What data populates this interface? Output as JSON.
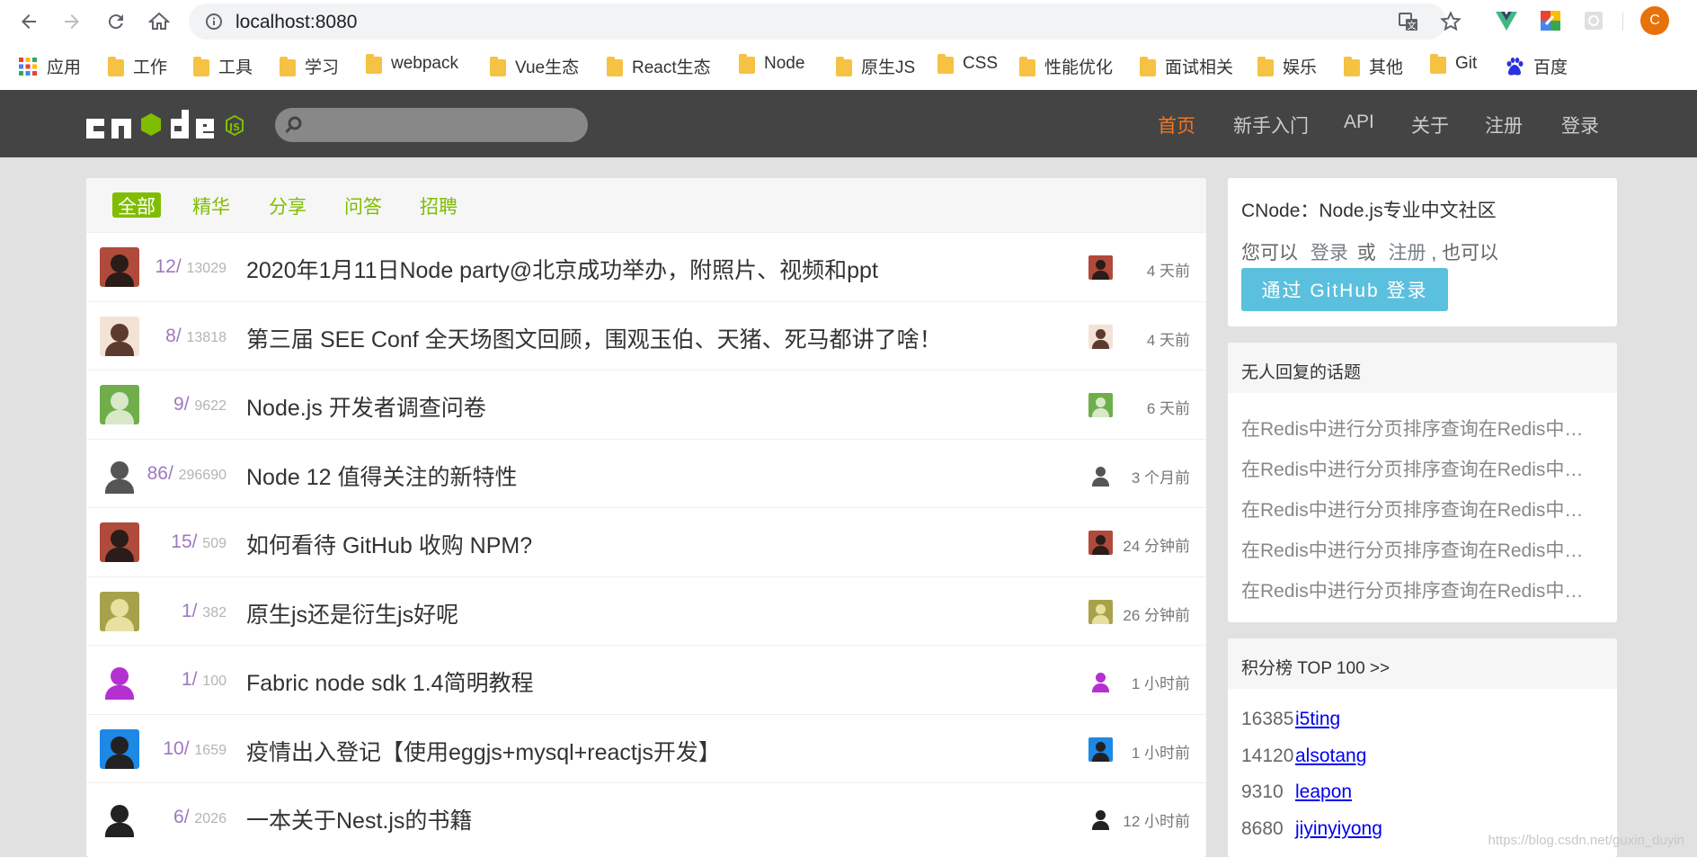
{
  "browser": {
    "url": "localhost:8080",
    "profile_initial": "C",
    "bookmarks": [
      "应用",
      "工作",
      "工具",
      "学习",
      "webpack",
      "Vue生态",
      "React生态",
      "Node",
      "原生JS",
      "CSS",
      "性能优化",
      "面试相关",
      "娱乐",
      "其他",
      "Git",
      "百度"
    ]
  },
  "header": {
    "nav": [
      "首页",
      "新手入门",
      "API",
      "关于",
      "注册",
      "登录"
    ]
  },
  "tabs": [
    "全部",
    "精华",
    "分享",
    "问答",
    "招聘"
  ],
  "topics": [
    {
      "replies": "12",
      "visits": "13029",
      "title": "2020年1月11日Node party@北京成功举办，附照片、视频和ppt",
      "time": "4 天前"
    },
    {
      "replies": "8",
      "visits": "13818",
      "title": "第三届 SEE Conf 全天场图文回顾，围观玉伯、天猪、死马都讲了啥！",
      "time": "4 天前"
    },
    {
      "replies": "9",
      "visits": "9622",
      "title": "Node.js 开发者调查问卷",
      "time": "6 天前"
    },
    {
      "replies": "86",
      "visits": "296690",
      "title": "Node 12 值得关注的新特性",
      "time": "3 个月前"
    },
    {
      "replies": "15",
      "visits": "509",
      "title": "如何看待 GitHub 收购 NPM?",
      "time": "24 分钟前"
    },
    {
      "replies": "1",
      "visits": "382",
      "title": "原生js还是衍生js好呢",
      "time": "26 分钟前"
    },
    {
      "replies": "1",
      "visits": "100",
      "title": "Fabric node sdk 1.4简明教程",
      "time": "1 小时前"
    },
    {
      "replies": "10",
      "visits": "1659",
      "title": "疫情出入登记【使用eggjs+mysql+reactjs开发】",
      "time": "1 小时前"
    },
    {
      "replies": "6",
      "visits": "2026",
      "title": "一本关于Nest.js的书籍",
      "time": "12 小时前"
    }
  ],
  "sidebar": {
    "intro": "CNode：Node.js专业中文社区",
    "login_pre": "您可以",
    "login_link": "登录",
    "or": "或",
    "register_link": "注册",
    "login_post": ", 也可以",
    "github_btn": "通过 GitHub 登录",
    "no_reply_title": "无人回复的话题",
    "no_reply": [
      "在Redis中进行分页排序查询在Redis中进行分页排序查询",
      "在Redis中进行分页排序查询在Redis中进行分页排序查询",
      "在Redis中进行分页排序查询在Redis中进行分页排序查询",
      "在Redis中进行分页排序查询在Redis中进行分页排序查询",
      "在Redis中进行分页排序查询在Redis中进行分页排序查询"
    ],
    "rank_title": "积分榜 TOP 100 >>",
    "rank": [
      {
        "score": "16385",
        "name": "i5ting"
      },
      {
        "score": "14120",
        "name": "alsotang"
      },
      {
        "score": "9310",
        "name": "leapon"
      },
      {
        "score": "8680",
        "name": "jiyinyiyong"
      }
    ]
  },
  "watermark": "https://blog.csdn.net/guxin_duyin",
  "colors": {
    "accent": "#80bd01",
    "header": "#444444",
    "active_nav": "#f57620",
    "github": "#5bc0de"
  }
}
